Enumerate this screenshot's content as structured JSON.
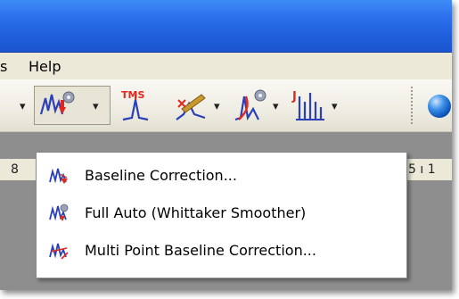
{
  "menubar": {
    "partial_item": "s",
    "help_label": "Help"
  },
  "toolbar": {
    "buttons": [
      {
        "icon": "baseline-auto-icon",
        "has_dropdown": true,
        "pressed": true
      },
      {
        "icon": "tms-reference-icon",
        "has_dropdown": false
      },
      {
        "icon": "peak-picking-icon",
        "has_dropdown": true
      },
      {
        "icon": "integration-icon",
        "has_dropdown": true
      },
      {
        "icon": "multiplet-icon",
        "has_dropdown": true
      },
      {
        "icon": "globe-icon",
        "has_dropdown": false
      }
    ]
  },
  "ruler": {
    "left_tick": "8",
    "right_ticks": "5 ı 1"
  },
  "dropdown": {
    "items": [
      {
        "label": "Baseline Correction...",
        "icon": "baseline-correction-icon"
      },
      {
        "label": "Full Auto (Whittaker Smoother)",
        "icon": "full-auto-baseline-icon"
      },
      {
        "label": "Multi Point Baseline Correction...",
        "icon": "multipoint-baseline-icon"
      }
    ]
  },
  "colors": {
    "titlebar": "#2d72ec",
    "menubar": "#ece9d8",
    "background": "#8e8e8e",
    "spectrum_blue": "#2a3fb8",
    "accent_red": "#e0281e"
  }
}
